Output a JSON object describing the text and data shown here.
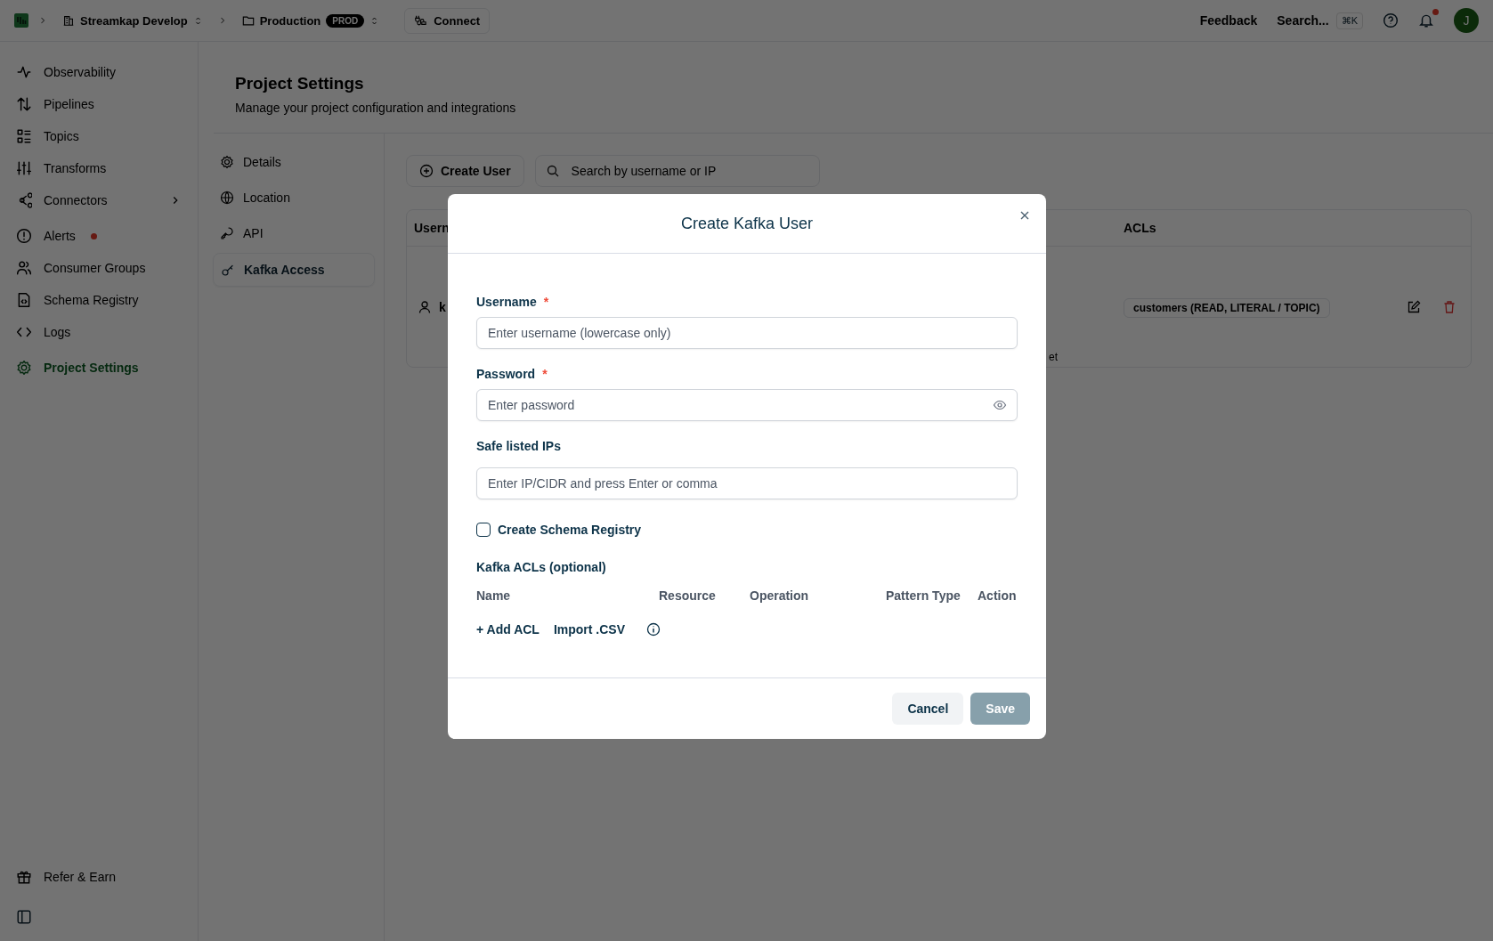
{
  "topbar": {
    "org": "Streamkap Develop",
    "project": "Production",
    "project_badge": "PROD",
    "connect": "Connect",
    "feedback": "Feedback",
    "search": "Search...",
    "shortcut": "⌘K",
    "avatar": "J",
    "notifications_unread": true
  },
  "sidebar": {
    "items": [
      {
        "label": "Observability",
        "selected": false,
        "chevron": false,
        "alert_dot": false
      },
      {
        "label": "Pipelines",
        "selected": false,
        "chevron": false,
        "alert_dot": false
      },
      {
        "label": "Topics",
        "selected": false,
        "chevron": false,
        "alert_dot": false
      },
      {
        "label": "Transforms",
        "selected": false,
        "chevron": false,
        "alert_dot": false
      },
      {
        "label": "Connectors",
        "selected": false,
        "chevron": true,
        "alert_dot": false
      },
      {
        "label": "Alerts",
        "selected": false,
        "chevron": false,
        "alert_dot": true
      },
      {
        "label": "Consumer Groups",
        "selected": false,
        "chevron": false,
        "alert_dot": false
      },
      {
        "label": "Schema Registry",
        "selected": false,
        "chevron": false,
        "alert_dot": false
      },
      {
        "label": "Logs",
        "selected": false,
        "chevron": false,
        "alert_dot": false
      },
      {
        "label": "Project Settings",
        "selected": true,
        "chevron": false,
        "alert_dot": false
      }
    ],
    "footer_items": [
      {
        "label": "Refer & Earn"
      }
    ]
  },
  "page": {
    "title": "Project Settings",
    "subtitle": "Manage your project configuration and integrations"
  },
  "settings_nav": [
    {
      "label": "Details",
      "selected": false
    },
    {
      "label": "Location",
      "selected": false
    },
    {
      "label": "API",
      "selected": false
    },
    {
      "label": "Kafka Access",
      "selected": true
    }
  ],
  "toolbar": {
    "create_button": "Create User",
    "search": {
      "placeholder": "Search by username or IP"
    }
  },
  "table": {
    "columns": [
      "Usern",
      "ACLs"
    ],
    "rows": [
      {
        "username": "k",
        "column_2": "et",
        "acls": [
          "customers (READ, LITERAL / TOPIC)"
        ]
      }
    ]
  },
  "modal": {
    "title": "Create Kafka User",
    "fields": [
      {
        "label": "Username",
        "required_mark": "*",
        "placeholder": "Enter username (lowercase only)",
        "kind": "text"
      },
      {
        "label": "Password",
        "required_mark": "*",
        "placeholder": "Enter password",
        "kind": "password"
      },
      {
        "label": "Safe listed IPs",
        "placeholder": "Enter IP/CIDR and press Enter or comma",
        "kind": "tags"
      }
    ],
    "checkbox": {
      "label": "Create Schema Registry",
      "checked": false
    },
    "acls": {
      "title": "Kafka ACLs (optional)",
      "columns": [
        "Name",
        "Resource",
        "Operation",
        "Pattern Type",
        "Action"
      ],
      "add": "+ Add ACL",
      "import": "Import .CSV"
    },
    "buttons": [
      {
        "label": "Cancel",
        "kind": "secondary",
        "disabled": false
      },
      {
        "label": "Save",
        "kind": "primary",
        "disabled": true
      }
    ]
  }
}
